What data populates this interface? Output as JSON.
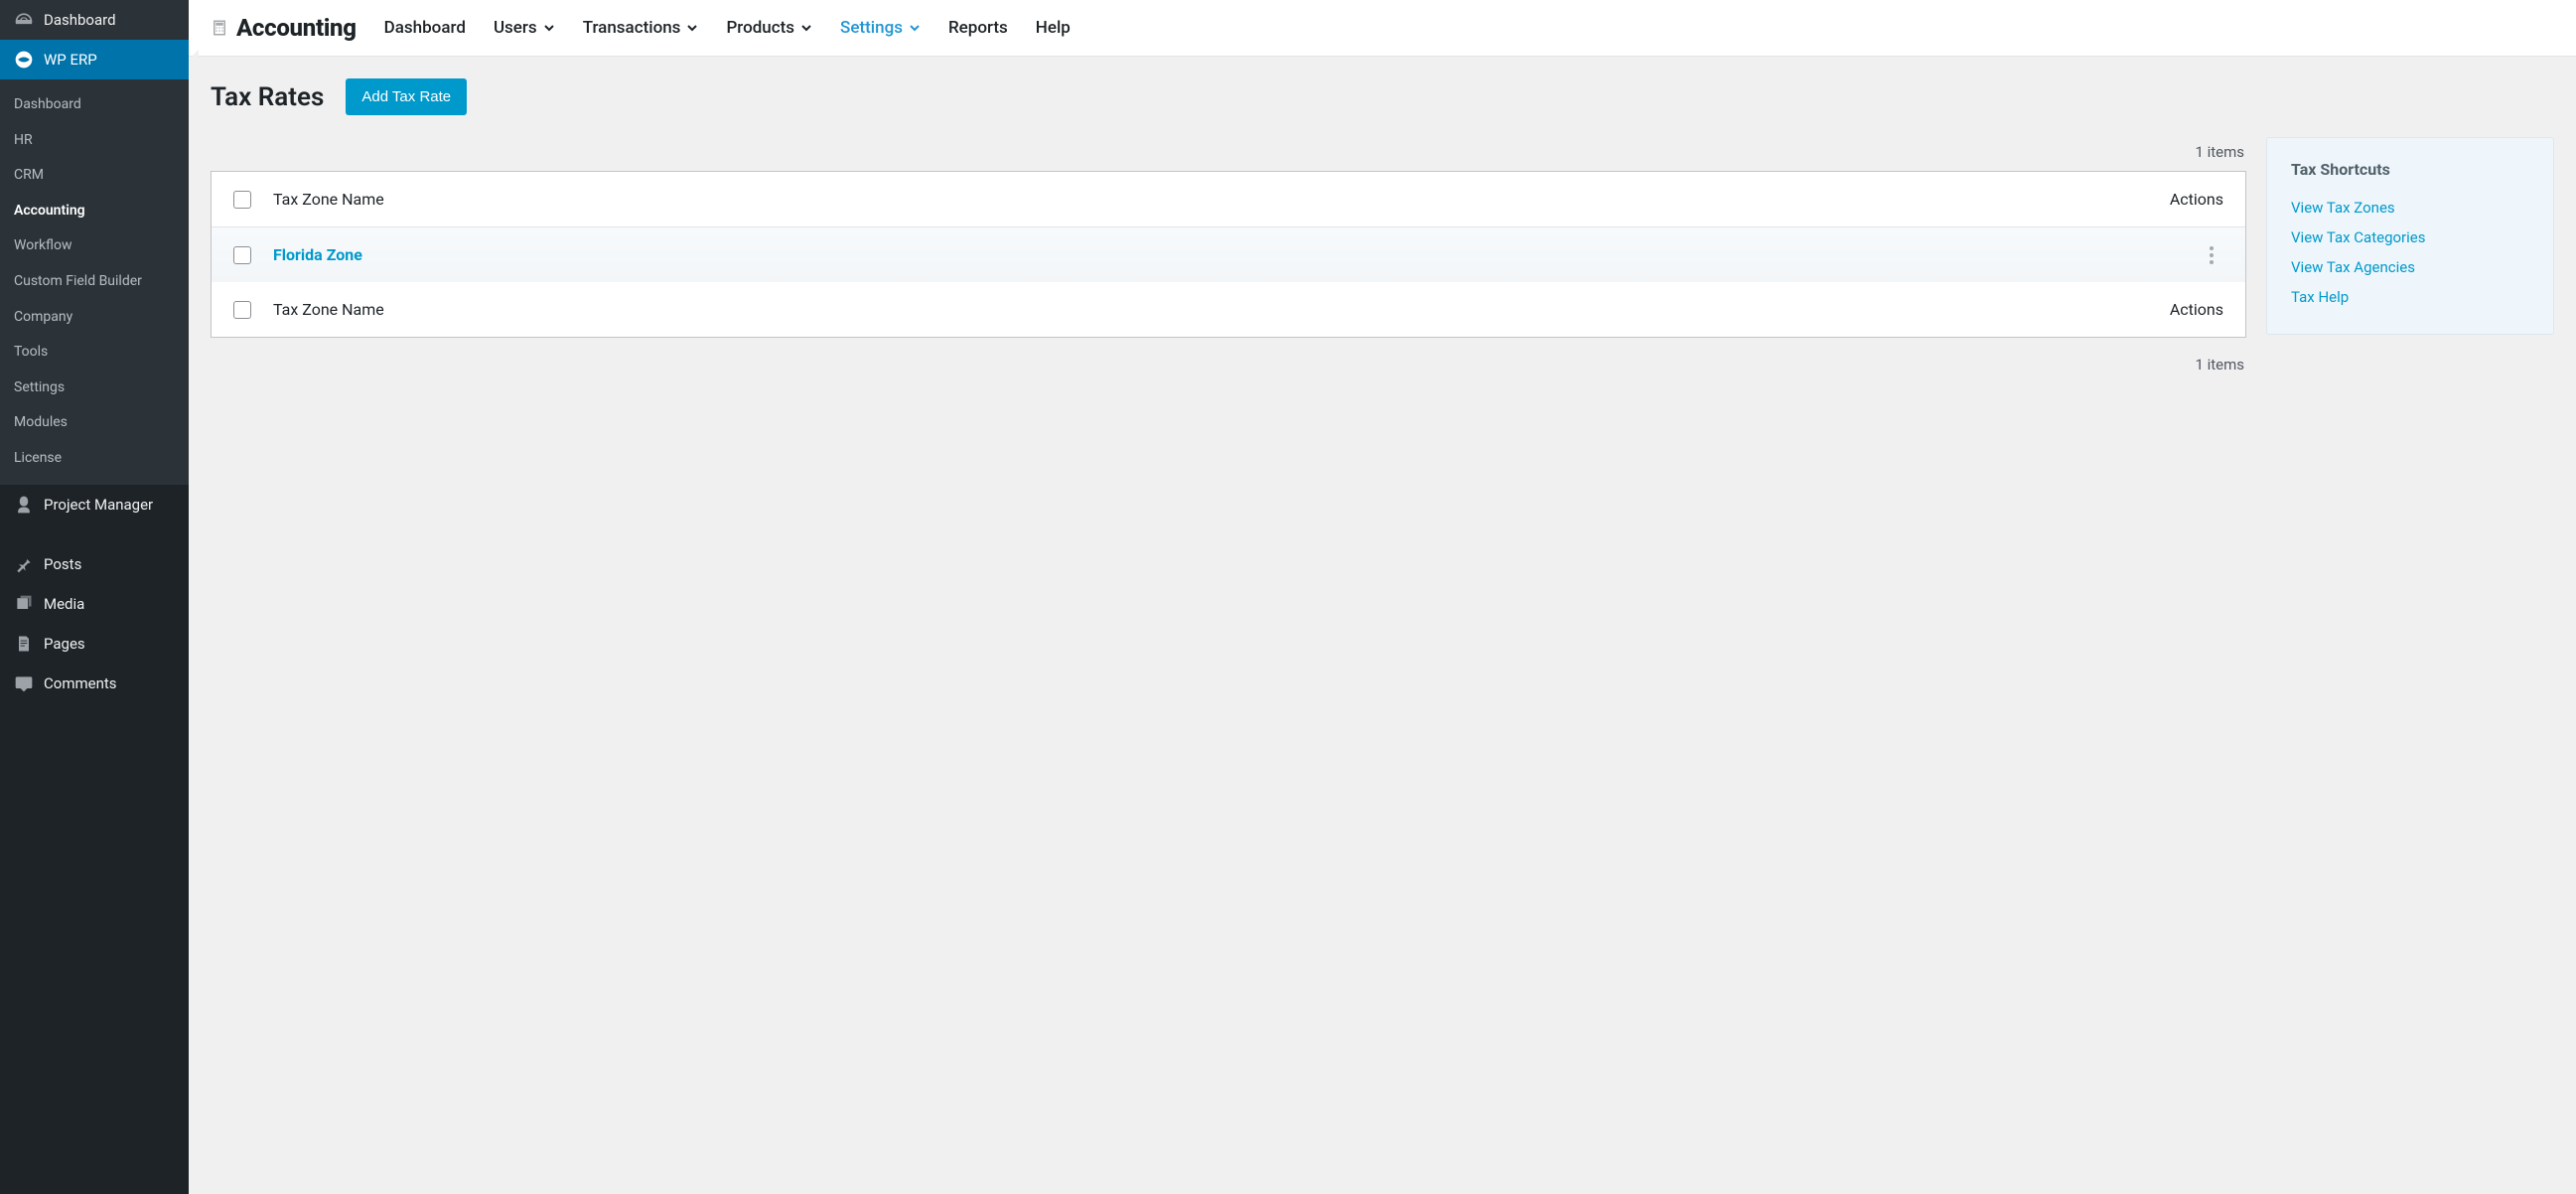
{
  "sidebar": {
    "dashboard": "Dashboard",
    "wp_erp": "WP ERP",
    "submenu": [
      "Dashboard",
      "HR",
      "CRM",
      "Accounting",
      "Workflow",
      "Custom Field Builder",
      "Company",
      "Tools",
      "Settings",
      "Modules",
      "License"
    ],
    "submenu_active_index": 3,
    "project_manager": "Project Manager",
    "posts": "Posts",
    "media": "Media",
    "pages": "Pages",
    "comments": "Comments"
  },
  "topnav": {
    "brand": "Accounting",
    "items": [
      {
        "label": "Dashboard",
        "dropdown": false
      },
      {
        "label": "Users",
        "dropdown": true
      },
      {
        "label": "Transactions",
        "dropdown": true
      },
      {
        "label": "Products",
        "dropdown": true
      },
      {
        "label": "Settings",
        "dropdown": true,
        "active": true
      },
      {
        "label": "Reports",
        "dropdown": false
      },
      {
        "label": "Help",
        "dropdown": false
      }
    ]
  },
  "page": {
    "title": "Tax Rates",
    "add_button": "Add Tax Rate",
    "item_count": "1 items",
    "header_name": "Tax Zone Name",
    "header_actions": "Actions",
    "footer_name": "Tax Zone Name",
    "footer_actions": "Actions",
    "rows": [
      {
        "name": "Florida Zone"
      }
    ]
  },
  "shortcuts": {
    "title": "Tax Shortcuts",
    "links": [
      "View Tax Zones",
      "View Tax Categories",
      "View Tax Agencies",
      "Tax Help"
    ]
  }
}
